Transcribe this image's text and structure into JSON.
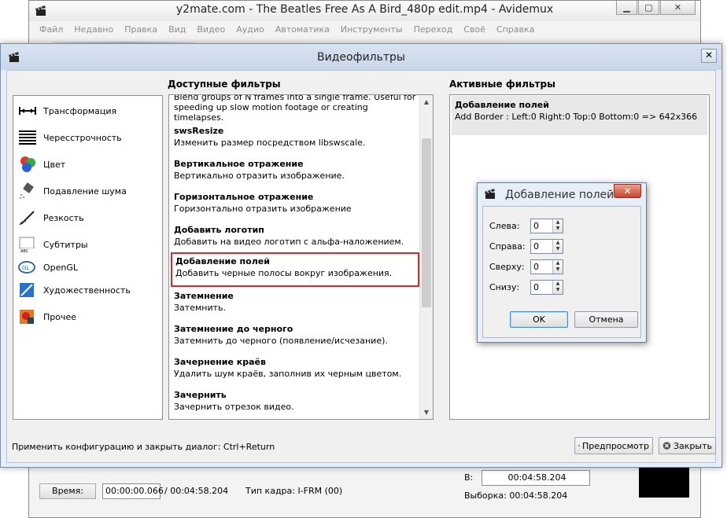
{
  "main_window": {
    "title": "y2mate.com - The Beatles Free As A Bird_480p edit.mp4 - Avidemux",
    "menu": [
      "Файл",
      "Недавно",
      "Правка",
      "Вид",
      "Видео",
      "Аудио",
      "Автоматика",
      "Инструменты",
      "Переход",
      "Своё",
      "Справка"
    ],
    "time_button": "Время:",
    "time_value": "00:00:00.066",
    "total_time": "/ 00:04:58.204",
    "frame_type": "Тип кадра:  I-FRM (00)",
    "b_label": "В:",
    "b_value": "00:04:58.204",
    "selection": "Выборка: 00:04:58.204"
  },
  "filters_dialog": {
    "title": "Видеофильтры",
    "available_heading": "Доступные фильтры",
    "active_heading": "Активные фильтры",
    "categories": [
      {
        "label": "Трансформация",
        "icon": "transform-icon"
      },
      {
        "label": "Чересстрочность",
        "icon": "interlace-icon"
      },
      {
        "label": "Цвет",
        "icon": "color-icon"
      },
      {
        "label": "Подавление шума",
        "icon": "noise-icon"
      },
      {
        "label": "Резкость",
        "icon": "sharpness-icon"
      },
      {
        "label": "Субтитры",
        "icon": "subtitles-icon"
      },
      {
        "label": "OpenGL",
        "icon": "opengl-icon"
      },
      {
        "label": "Художественность",
        "icon": "art-icon"
      },
      {
        "label": "Прочее",
        "icon": "misc-icon"
      }
    ],
    "filters": [
      {
        "name": "",
        "desc": "Blend groups of N frames into a single frame.  Useful for speeding up slow motion footage or creating timelapses."
      },
      {
        "name": "swsResize",
        "desc": "Изменить размер посредством libswscale."
      },
      {
        "name": "Вертикальное отражение",
        "desc": "Вертикально отразить изображение."
      },
      {
        "name": "Горизонтальное отражение",
        "desc": "Горизонтально отразить изображение"
      },
      {
        "name": "Добавить логотип",
        "desc": "Добавить на видео логотип с альфа-наложением."
      },
      {
        "name": "Добавление полей",
        "desc": "Добавить черные полосы вокруг изображения."
      },
      {
        "name": "Затемнение",
        "desc": "Затемнить."
      },
      {
        "name": "Затемнение до черного",
        "desc": "Затемнить до черного (появление/исчезание)."
      },
      {
        "name": "Зачернение краёв",
        "desc": "Удалить шум краёв, заполнив их черным цветом."
      },
      {
        "name": "Зачернить",
        "desc": "Зачернить отрезок видео."
      }
    ],
    "active_filter": {
      "name": "Добавление полей",
      "desc": "Add Border : Left:0 Right:0 Top:0 Bottom:0 => 642x366"
    },
    "hint": "Применить конфигурацию и закрыть диалог: Ctrl+Return",
    "preview_button": "Предпросмотр",
    "close_button": "Закрыть"
  },
  "border_dialog": {
    "title": "Добавление полей",
    "fields": [
      {
        "label": "Слева:",
        "value": "0"
      },
      {
        "label": "Справа:",
        "value": "0"
      },
      {
        "label": "Сверху:",
        "value": "0"
      },
      {
        "label": "Снизу:",
        "value": "0"
      }
    ],
    "ok": "OK",
    "cancel": "Отмена"
  },
  "colors": {
    "selection_outline": "#d22b2b",
    "dialog_title_bg": "#c8d6ea",
    "close_red": "#c8452e"
  }
}
